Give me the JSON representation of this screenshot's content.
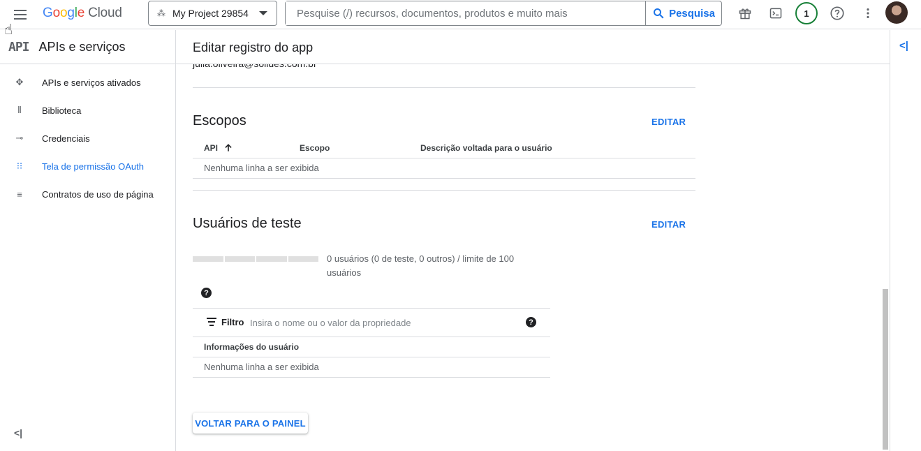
{
  "topbar": {
    "logo_google": [
      "G",
      "o",
      "o",
      "g",
      "l",
      "e"
    ],
    "logo_cloud": "Cloud",
    "project_name": "My Project 29854",
    "search_placeholder": "Pesquise (/) recursos, documentos, produtos e muito mais",
    "search_button": "Pesquisa",
    "notification_count": "1",
    "icons": [
      "menu-icon",
      "gift-icon",
      "terminal-icon",
      "help-icon",
      "more-vert-icon"
    ]
  },
  "sidebar": {
    "api_logo": "API",
    "title": "APIs e serviços",
    "items": [
      {
        "label": "APIs e serviços ativados",
        "icon": "apis-icon",
        "active": false
      },
      {
        "label": "Biblioteca",
        "icon": "library-icon",
        "active": false
      },
      {
        "label": "Credenciais",
        "icon": "key-icon",
        "active": false
      },
      {
        "label": "Tela de permissão OAuth",
        "icon": "oauth-icon",
        "active": true
      },
      {
        "label": "Contratos de uso de página",
        "icon": "page-settings-icon",
        "active": false
      }
    ],
    "collapse_icon": "collapse-left-icon"
  },
  "main": {
    "header_title": "Editar registro do app",
    "email_partial": "julia.oliveira@solides.com.br",
    "scopes": {
      "title": "Escopos",
      "edit": "EDITAR",
      "columns": [
        "API",
        "Escopo",
        "Descrição voltada para o usuário"
      ],
      "sort_column": "API",
      "empty": "Nenhuma linha a ser exibida"
    },
    "test_users": {
      "title": "Usuários de teste",
      "edit": "EDITAR",
      "usage_text": "0 usuários (0 de teste, 0 outros) / limite de 100 usuários",
      "usage_fraction": 0,
      "filter_label": "Filtro",
      "filter_placeholder": "Insira o nome ou o valor da propriedade",
      "column": "Informações do usuário",
      "empty": "Nenhuma linha a ser exibida"
    },
    "back_button": "VOLTAR PARA O PAINEL"
  },
  "colors": {
    "accent": "#1a73e8",
    "badge_ring": "#188038"
  }
}
